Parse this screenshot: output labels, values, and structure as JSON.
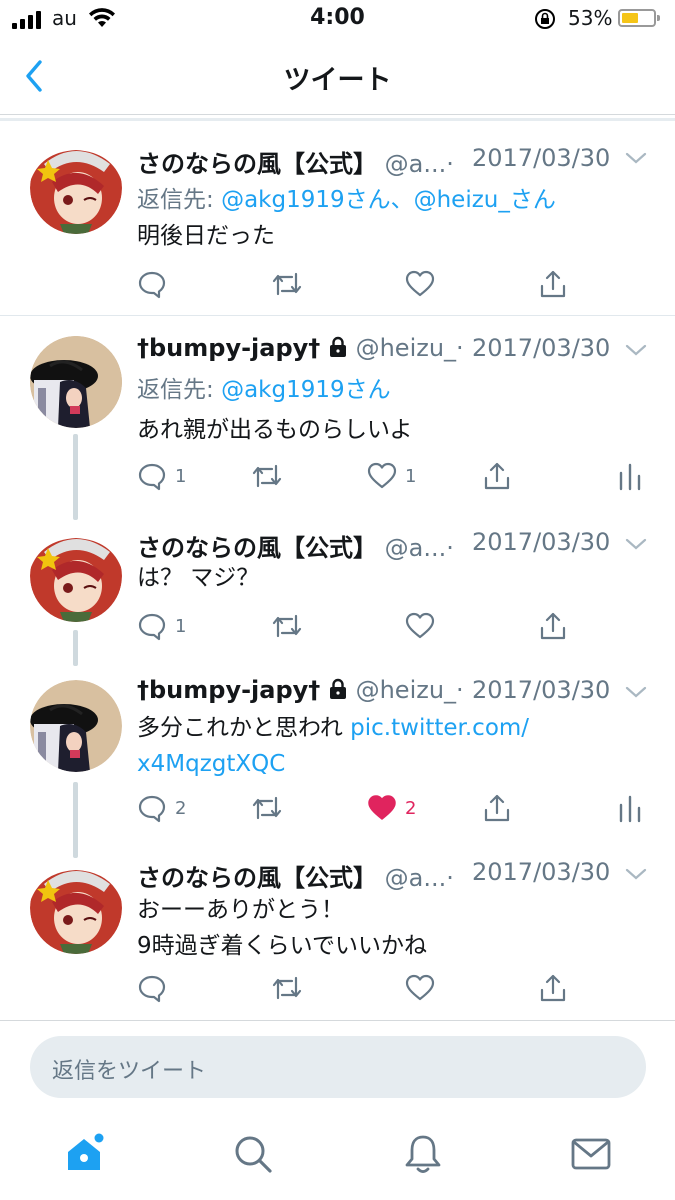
{
  "status_bar": {
    "carrier": "au",
    "time": "4:00",
    "battery_percent": "53%",
    "battery_level": 0.53,
    "battery_color": "#f5c518"
  },
  "nav": {
    "title": "ツイート",
    "back_icon": "chevron-left-icon"
  },
  "colors": {
    "accent": "#1da1f2",
    "like": "#e0245e",
    "secondary_text": "#657786"
  },
  "tweets": [
    {
      "name": "さのならの風【公式】",
      "handle": "@a...",
      "dot": "·",
      "date": "2017/03/30",
      "reply_prefix": "返信先:",
      "reply_to": "@akg1919さん、@heizu_さん",
      "text_lines": [
        "明後日だった"
      ],
      "reply_count": "",
      "like_count": "",
      "liked": false
    },
    {
      "name": "†bumpy-japy†",
      "handle": "@heizu_",
      "dot": "·",
      "date": "2017/03/30",
      "reply_prefix": "返信先:",
      "reply_to": "@akg1919さん",
      "text_lines": [
        "あれ親が出るものらしいよ"
      ],
      "reply_count": "1",
      "like_count": "1",
      "liked": false
    },
    {
      "name": "さのならの風【公式】",
      "handle": "@a...",
      "dot": "·",
      "date": "2017/03/30",
      "text_lines": [
        "は？ マジ？"
      ],
      "reply_count": "1",
      "like_count": "",
      "liked": false
    },
    {
      "name": "†bumpy-japy†",
      "handle": "@heizu_",
      "dot": "·",
      "date": "2017/03/30",
      "text_plain": "多分これかと思われ ",
      "text_link_1": "pic.twitter.com/",
      "text_link_2": "x4MqzgtXQC",
      "reply_count": "2",
      "like_count": "2",
      "liked": true
    },
    {
      "name": "さのならの風【公式】",
      "handle": "@a...",
      "dot": "·",
      "date": "2017/03/30",
      "text_lines": [
        "おーーありがとう！",
        "9時過ぎ着くらいでいいかね"
      ],
      "reply_count": "",
      "like_count": "",
      "liked": false
    }
  ],
  "composer": {
    "placeholder": "返信をツイート"
  },
  "tabbar": {
    "items": [
      "home-icon",
      "search-icon",
      "notifications-icon",
      "messages-icon"
    ],
    "active": "home-icon"
  }
}
